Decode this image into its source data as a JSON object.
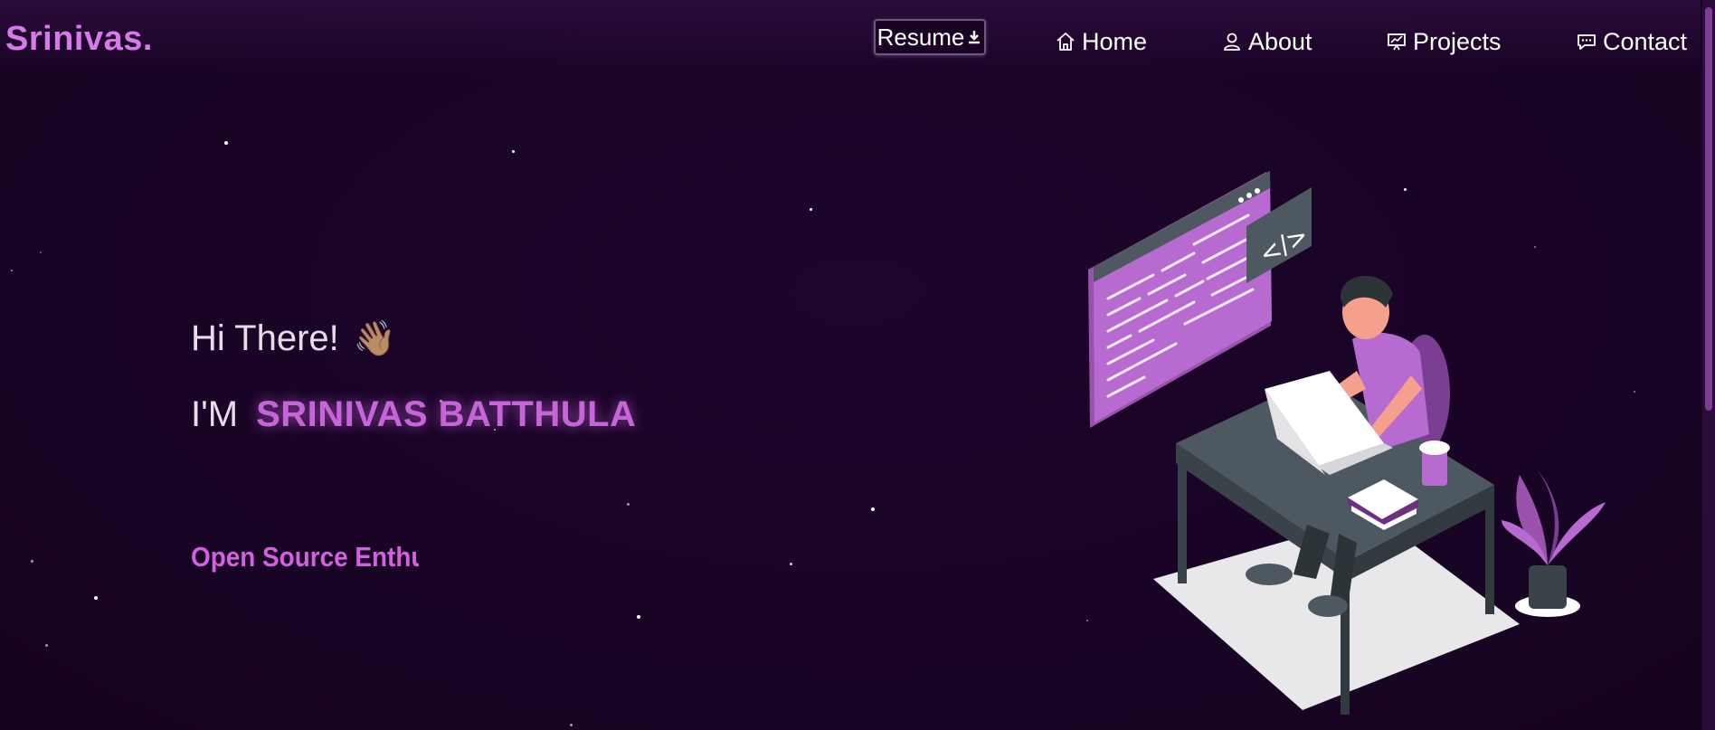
{
  "brand": {
    "name": "Srinivas."
  },
  "nav": {
    "resume_label": "Resume",
    "items": [
      {
        "label": "Home",
        "icon": "home-icon"
      },
      {
        "label": "About",
        "icon": "user-icon"
      },
      {
        "label": "Projects",
        "icon": "presentation-chart-icon"
      },
      {
        "label": "Contact",
        "icon": "chat-bubble-icon"
      }
    ]
  },
  "hero": {
    "greeting": "Hi There!",
    "wave_emoji": "👋🏽",
    "intro_prefix": "I'M",
    "name": "SRINIVAS BATTHULA",
    "typewriter_text": "Open Source Enthus"
  },
  "colors": {
    "background": "#1a0426",
    "accent": "#c565d8",
    "brand": "#d57ae8",
    "text": "#e6dcea"
  }
}
